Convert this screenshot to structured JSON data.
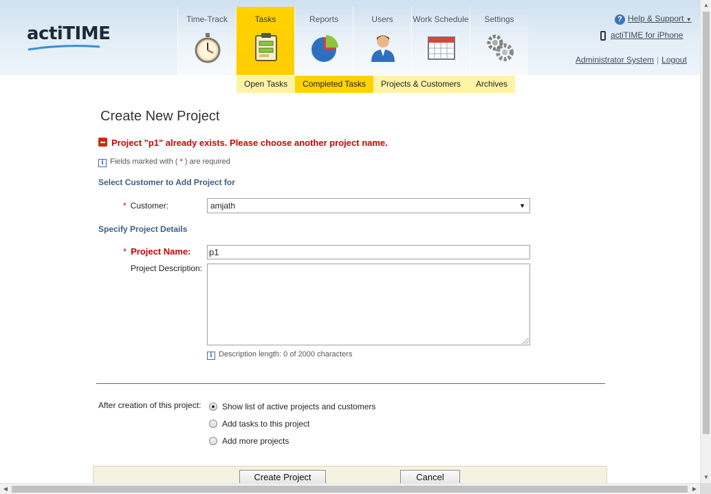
{
  "header": {
    "logo": "actiTIME",
    "help_label": "Help & Support",
    "iphone_label": "actiTIME for iPhone",
    "user_label": "Administrator System",
    "logout_label": "Logout"
  },
  "nav": {
    "items": [
      {
        "label": "Time-Track",
        "icon": "stopwatch-icon"
      },
      {
        "label": "Tasks",
        "icon": "clipboard-icon",
        "active": true
      },
      {
        "label": "Reports",
        "icon": "pie-chart-icon"
      },
      {
        "label": "Users",
        "icon": "user-icon"
      },
      {
        "label": "Work Schedule",
        "icon": "calendar-icon"
      },
      {
        "label": "Settings",
        "icon": "gears-icon"
      }
    ]
  },
  "subnav": {
    "items": [
      "Open Tasks",
      "Completed Tasks",
      "Projects & Customers",
      "Archives"
    ],
    "active": "Completed Tasks"
  },
  "page": {
    "title": "Create New Project",
    "error": "Project \"p1\" already exists. Please choose another project name.",
    "required_prefix": "Fields marked with (",
    "required_star": "*",
    "required_suffix": ") are required",
    "section_customer": "Select Customer to Add Project for",
    "customer_label": "Customer:",
    "customer_value": "amjath",
    "section_details": "Specify Project Details",
    "project_name_label": "Project Name:",
    "project_name_value": "p1",
    "description_label": "Project Description:",
    "description_value": "",
    "desc_length": "Description length: 0 of 2000 characters",
    "after_label": "After creation of this project:",
    "options": [
      {
        "label": "Show list of active projects and customers",
        "selected": true
      },
      {
        "label": "Add tasks to this project",
        "selected": false
      },
      {
        "label": "Add more projects",
        "selected": false
      }
    ],
    "create_button": "Create Project",
    "cancel_button": "Cancel"
  },
  "colors": {
    "accent_yellow": "#ffd200",
    "error_red": "#cc0000",
    "section_blue": "#3d5f80"
  }
}
